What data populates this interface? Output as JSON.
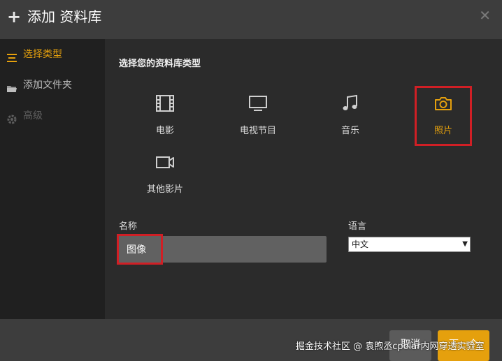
{
  "dialog": {
    "title": "添加 资料库"
  },
  "sidebar": {
    "items": [
      {
        "label": "选择类型",
        "icon": "list-icon",
        "state": "active"
      },
      {
        "label": "添加文件夹",
        "icon": "folder-icon",
        "state": "normal"
      },
      {
        "label": "高级",
        "icon": "gear-icon",
        "state": "disabled"
      }
    ]
  },
  "main": {
    "section_title": "选择您的资料库类型",
    "types": [
      {
        "label": "电影",
        "icon": "film-icon",
        "selected": false
      },
      {
        "label": "电视节目",
        "icon": "tv-icon",
        "selected": false
      },
      {
        "label": "音乐",
        "icon": "music-icon",
        "selected": false
      },
      {
        "label": "照片",
        "icon": "camera-icon",
        "selected": true
      },
      {
        "label": "其他影片",
        "icon": "video-camera-icon",
        "selected": false
      }
    ],
    "name_label": "名称",
    "name_value": "图像",
    "language_label": "语言",
    "language_value": "中文"
  },
  "footer": {
    "cancel_label": "取消",
    "next_label": "下一个",
    "watermark": "掘金技术社区 @ 袁煦丞cpolar内网穿透实验室"
  },
  "colors": {
    "accent": "#e5a00d",
    "highlight_box": "#d01f25",
    "header_bg": "#3d3d3d",
    "sidebar_bg": "#202020",
    "content_bg": "#2b2b2b"
  }
}
